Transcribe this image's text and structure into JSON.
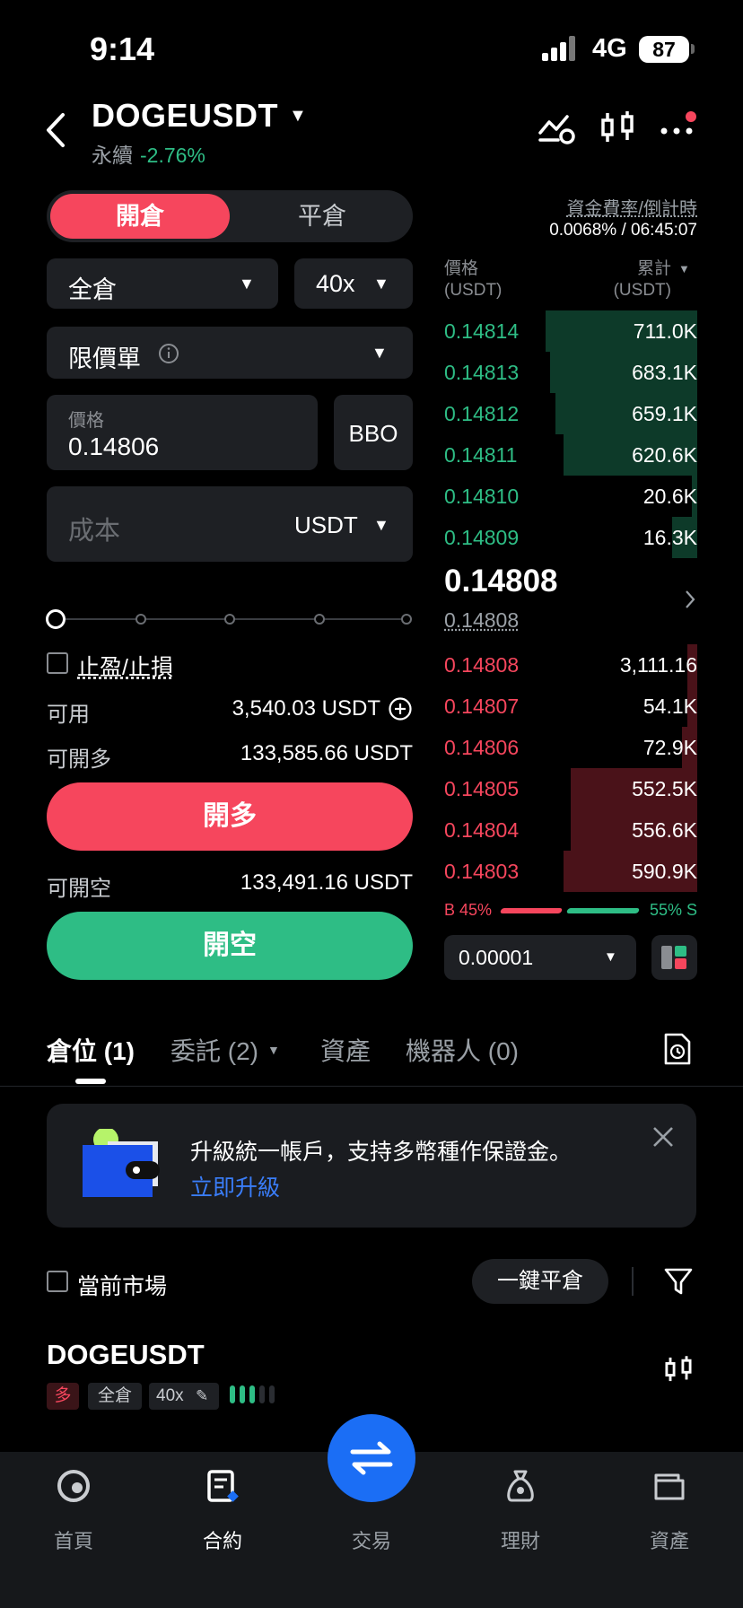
{
  "status_bar": {
    "time": "9:14",
    "network": "4G",
    "battery": "87"
  },
  "header": {
    "pair": "DOGEUSDT",
    "type": "永續",
    "change": "-2.76%"
  },
  "order_form": {
    "tab_open": "開倉",
    "tab_close": "平倉",
    "margin_mode": "全倉",
    "leverage": "40x",
    "order_type": "限價單",
    "price_label": "價格",
    "price_value": "0.14806",
    "bbo_label": "BBO",
    "cost_placeholder": "成本",
    "cost_unit": "USDT",
    "slider_percent": 0,
    "tpsl_label": "止盈/止損",
    "available_label": "可用",
    "available_value": "3,540.03 USDT",
    "max_long_label": "可開多",
    "max_long_value": "133,585.66 USDT",
    "long_button": "開多",
    "max_short_label": "可開空",
    "max_short_value": "133,491.16 USDT",
    "short_button": "開空"
  },
  "funding": {
    "label": "資金費率/倒計時",
    "value": "0.0068% / 06:45:07"
  },
  "order_book": {
    "price_header": "價格",
    "price_unit": "(USDT)",
    "total_header": "累計",
    "total_unit": "(USDT)",
    "asks": [
      {
        "price": "0.14814",
        "total": "711.0K",
        "depth": 0.6
      },
      {
        "price": "0.14813",
        "total": "683.1K",
        "depth": 0.58
      },
      {
        "price": "0.14812",
        "total": "659.1K",
        "depth": 0.56
      },
      {
        "price": "0.14811",
        "total": "620.6K",
        "depth": 0.53
      },
      {
        "price": "0.14810",
        "total": "20.6K",
        "depth": 0.02
      },
      {
        "price": "0.14809",
        "total": "16.3K",
        "depth": 0.1
      }
    ],
    "last_price": "0.14808",
    "mark_price": "0.14808",
    "bids": [
      {
        "price": "0.14808",
        "total": "3,111.16",
        "depth": 0.04
      },
      {
        "price": "0.14807",
        "total": "54.1K",
        "depth": 0.04
      },
      {
        "price": "0.14806",
        "total": "72.9K",
        "depth": 0.06
      },
      {
        "price": "0.14805",
        "total": "552.5K",
        "depth": 0.5
      },
      {
        "price": "0.14804",
        "total": "556.6K",
        "depth": 0.5
      },
      {
        "price": "0.14803",
        "total": "590.9K",
        "depth": 0.53
      }
    ],
    "buy_ratio": "B 45%",
    "sell_ratio": "55% S",
    "buy_fraction": 0.45,
    "tick_size": "0.00001"
  },
  "tabs": [
    {
      "label": "倉位 (1)"
    },
    {
      "label": "委託 (2)"
    },
    {
      "label": "資產"
    },
    {
      "label": "機器人 (0)"
    }
  ],
  "banner": {
    "text": "升級統一帳戶，支持多幣種作保證金。",
    "link": "立即升級"
  },
  "positions": {
    "current_market_label": "當前市場",
    "close_all_label": "一鍵平倉",
    "symbol": "DOGEUSDT",
    "side": "多",
    "mode": "全倉",
    "leverage": "40x"
  },
  "bottom_nav": [
    {
      "label": "首頁"
    },
    {
      "label": "合約"
    },
    {
      "label": "交易"
    },
    {
      "label": "理財"
    },
    {
      "label": "資產"
    }
  ],
  "colors": {
    "buy": "#2ebd85",
    "sell": "#f6465d",
    "accent": "#1b6ef5"
  }
}
